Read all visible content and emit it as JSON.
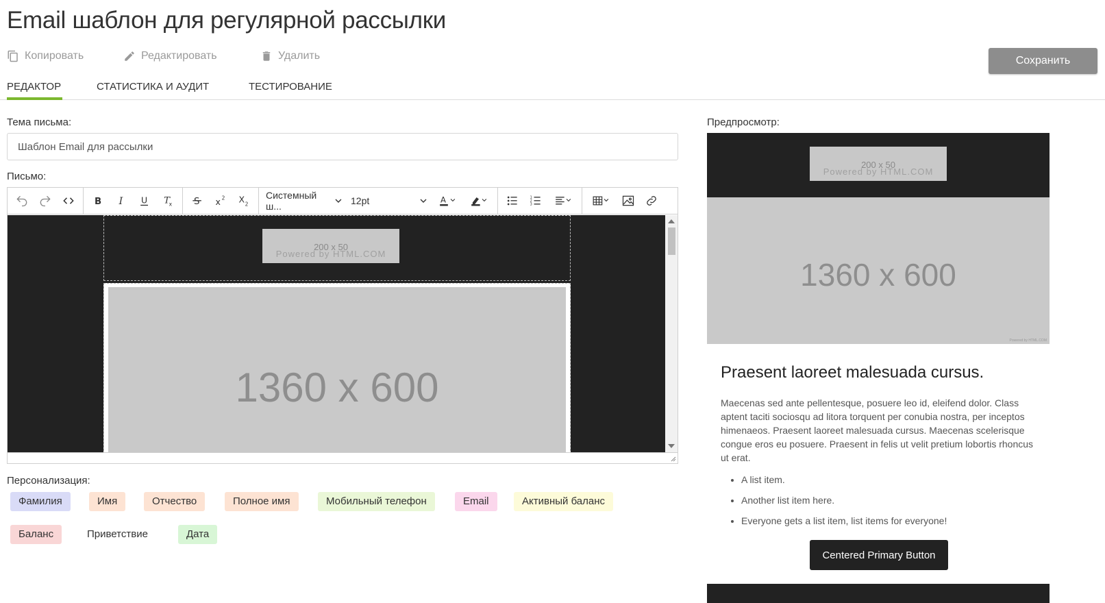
{
  "page": {
    "title": "Email шаблон для регулярной рассылки"
  },
  "actions": {
    "copy": "Копировать",
    "edit": "Редактировать",
    "delete": "Удалить",
    "save": "Сохранить"
  },
  "tabs": [
    {
      "label": "РЕДАКТОР",
      "active": true
    },
    {
      "label": "СТАТИСТИКА И АУДИТ",
      "active": false
    },
    {
      "label": "ТЕСТИРОВАНИЕ",
      "active": false
    }
  ],
  "form": {
    "subject_label": "Тема письма:",
    "subject_value": "Шаблон Email для рассылки",
    "letter_label": "Письмо:",
    "personalization_label": "Персонализация:"
  },
  "toolbar": {
    "font_family": "Системный ш...",
    "font_size": "12pt",
    "buttons": [
      "undo-icon",
      "redo-icon",
      "code-icon",
      "bold-icon",
      "italic-icon",
      "underline-icon",
      "clear-format-icon",
      "strikethrough-icon",
      "superscript-icon",
      "subscript-icon",
      "font-color-icon",
      "highlight-icon",
      "bullet-list-icon",
      "numbered-list-icon",
      "align-icon",
      "table-icon",
      "image-icon",
      "link-icon"
    ]
  },
  "editor_content": {
    "logo_size": "200 x 50",
    "logo_powered": "Powered by HTML.COM",
    "hero_size": "1360 x 600"
  },
  "chips": [
    {
      "label": "Фамилия",
      "color": "#d9dbf7"
    },
    {
      "label": "Имя",
      "color": "#fde3d3"
    },
    {
      "label": "Отчество",
      "color": "#fde3d3"
    },
    {
      "label": "Полное имя",
      "color": "#fde3d3"
    },
    {
      "label": "Мобильный телефон",
      "color": "#eaf7d7"
    },
    {
      "label": "Email",
      "color": "#fbd7ec"
    },
    {
      "label": "Активный баланс",
      "color": "#fdfbd9"
    },
    {
      "label": "Баланс",
      "color": "#f9d6d6"
    },
    {
      "label": "Приветствие",
      "color": "#ffffff"
    },
    {
      "label": "Дата",
      "color": "#d8f6d6"
    }
  ],
  "preview": {
    "label": "Предпросмотр:",
    "logo_size": "200 x 50",
    "logo_powered": "Powered by HTML.COM",
    "hero_size": "1360 x 600",
    "hero_powered": "Powered by HTML.COM",
    "heading": "Praesent laoreet malesuada cursus.",
    "paragraph": "Maecenas sed ante pellentesque, posuere leo id, eleifend dolor. Class aptent taciti sociosqu ad litora torquent per conubia nostra, per inceptos himenaeos. Praesent laoreet malesuada cursus. Maecenas scelerisque congue eros eu posuere. Praesent in felis ut velit pretium lobortis rhoncus ut erat.",
    "list": [
      "A list item.",
      "Another list item here.",
      "Everyone gets a list item, list items for everyone!"
    ],
    "button": "Centered Primary Button"
  },
  "colors": {
    "accent": "#7cb82f",
    "save_button": "#8d8d8d",
    "dark": "#222222",
    "placeholder": "#c9c9c9"
  }
}
